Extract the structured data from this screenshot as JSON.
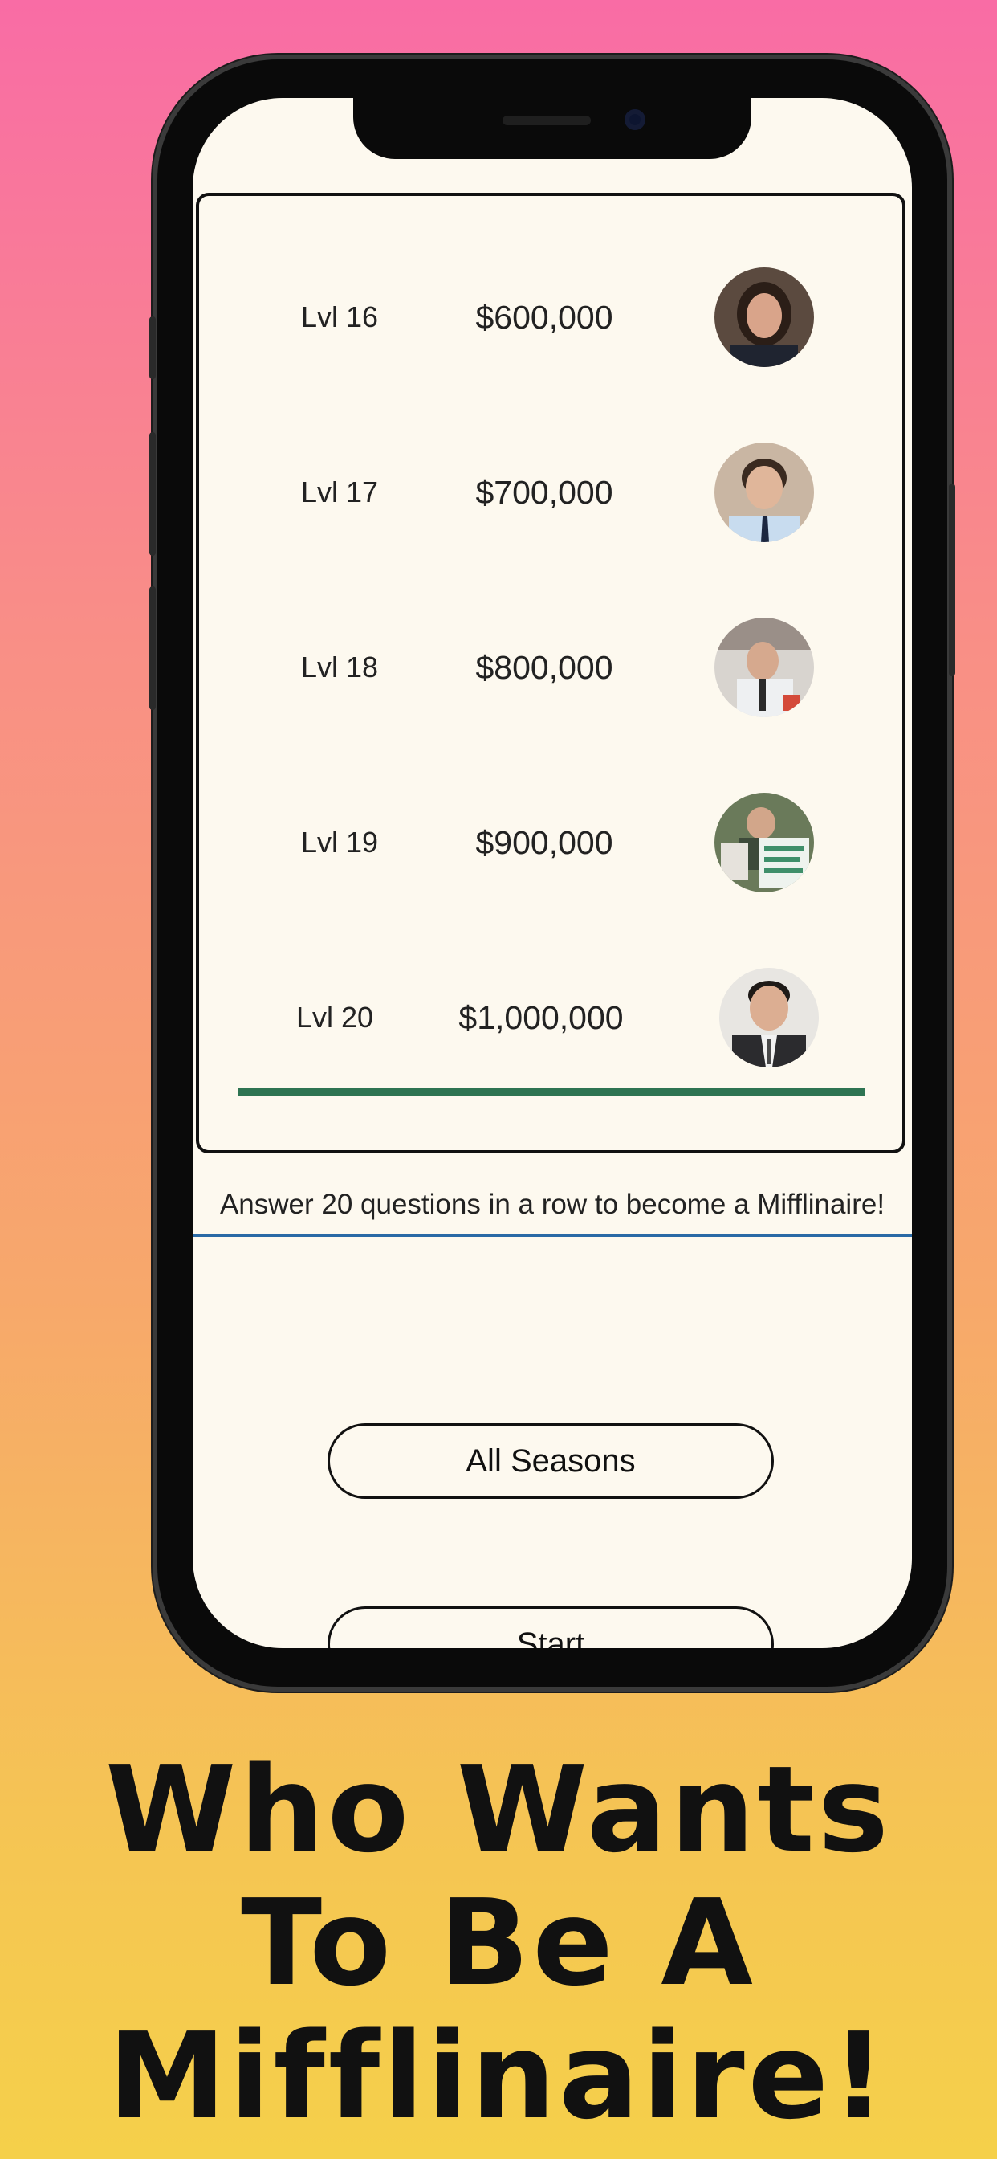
{
  "levels": [
    {
      "label": "Lvl 16",
      "amount": "$600,000",
      "avatar_icon": "character-avatar-1"
    },
    {
      "label": "Lvl 17",
      "amount": "$700,000",
      "avatar_icon": "character-avatar-2"
    },
    {
      "label": "Lvl 18",
      "amount": "$800,000",
      "avatar_icon": "character-avatar-3"
    },
    {
      "label": "Lvl 19",
      "amount": "$900,000",
      "avatar_icon": "character-avatar-4"
    },
    {
      "label": "Lvl 20",
      "amount": "$1,000,000",
      "avatar_icon": "character-avatar-5"
    }
  ],
  "tagline": "Answer 20 questions in a row to become a Mifflinaire!",
  "buttons": {
    "season_select": "All Seasons",
    "start": "Start"
  },
  "title_lines": [
    "Who Wants",
    "To Be A",
    "Mifflinaire!"
  ],
  "colors": {
    "background_top": "#f96ca5",
    "background_bottom": "#f5d04a",
    "screen_bg": "#fdf9ef",
    "progress_line": "#2e7452",
    "divider": "#2a6aa6"
  }
}
